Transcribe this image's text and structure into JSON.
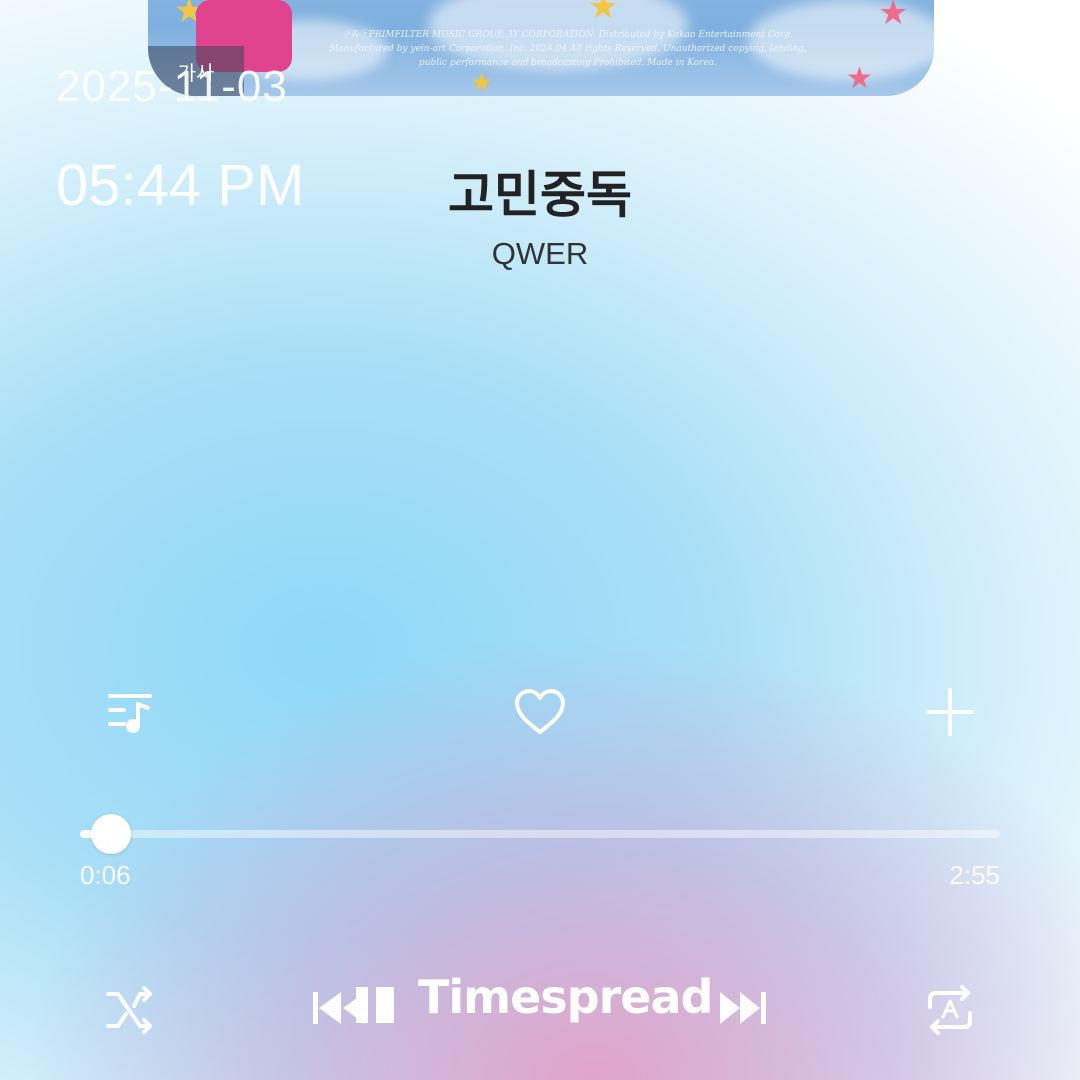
{
  "album": {
    "credit_lines": [
      "ⓟ&ⓒPRIMFILTER MUSIC GROUP, 3Y CORPORATION. Distributed by Kakao Entertainment Corp.",
      "Manufactured by yein-art Corporation.,Inc. 2024.04 All rights Reserved. Unauthorized copying, lending,",
      "public performance and broadcasting Prohibited. Made in Korea."
    ],
    "lyrics_tab_label": "가사"
  },
  "overlay": {
    "date": "2025-11-03",
    "time": "05:44 PM"
  },
  "track": {
    "title": "고민중독",
    "artist": "QWER",
    "elapsed": "0:06",
    "duration": "2:55",
    "progress_fraction": 0.034
  },
  "actions": {
    "playlist_icon": "playlist-music-icon",
    "like_icon": "heart-outline-icon",
    "add_icon": "plus-icon"
  },
  "controls": {
    "shuffle_icon": "shuffle-icon",
    "previous_icon": "skip-previous-icon",
    "pause_icon": "pause-icon",
    "next_icon": "skip-next-icon",
    "repeat_icon": "repeat-auto-icon"
  },
  "watermark": "Timespread",
  "colors": {
    "title": "#222222",
    "accent_pink": "#e0448f",
    "icon": "#ffffff"
  }
}
